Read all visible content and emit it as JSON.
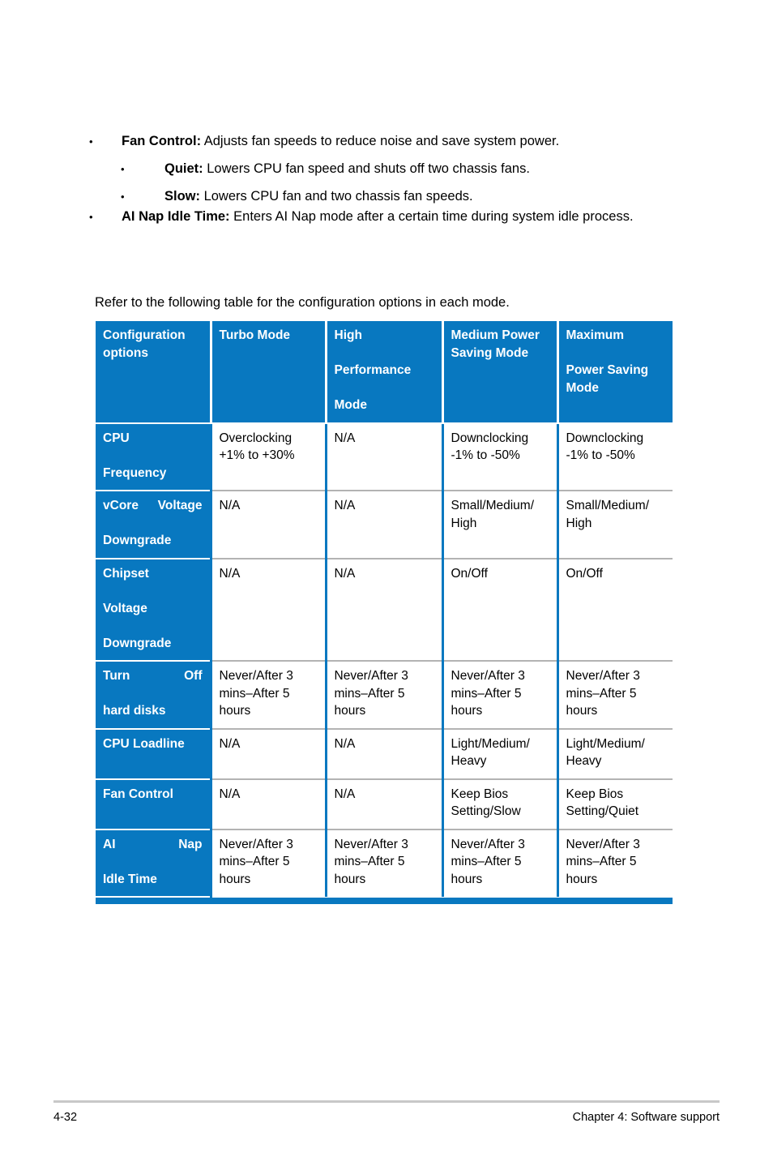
{
  "page": {
    "number": "4-32",
    "chapter_label": "Chapter 4: Software support"
  },
  "bullets": [
    {
      "level": 1,
      "marker": "•",
      "term": "Fan Control:",
      "text": " Adjusts fan speeds to reduce noise and save system power."
    },
    {
      "level": 2,
      "marker": "•",
      "term": "Quiet:",
      "text": " Lowers CPU fan speed and shuts off two chassis fans."
    },
    {
      "level": 2,
      "marker": "•",
      "term": "Slow:",
      "text": " Lowers CPU fan and two chassis fan speeds."
    },
    {
      "level": 1,
      "marker": "•",
      "term": "AI Nap Idle Time:",
      "text": " Enters AI Nap mode after a certain time during system idle process."
    }
  ],
  "intro": {
    "refer_text": "Refer to the following table for the configuration options in each mode."
  },
  "table": {
    "accent_color": "#0878c0",
    "header_text_color": "#ffffff",
    "row_separator_color": "#b3b3b3",
    "columns": [
      {
        "lines": [
          "Configuration",
          "options"
        ],
        "spread": [
          false,
          false
        ]
      },
      {
        "lines": [
          "Turbo Mode"
        ],
        "spread": [
          false
        ]
      },
      {
        "lines": [
          "High",
          "Performance",
          "Mode"
        ],
        "spread": [
          true,
          true,
          false
        ]
      },
      {
        "lines": [
          "Medium Power",
          "Saving Mode"
        ],
        "spread": [
          false,
          false
        ]
      },
      {
        "lines": [
          "Maximum",
          "Power Saving",
          "Mode"
        ],
        "spread": [
          true,
          false,
          false
        ]
      }
    ],
    "rows": [
      {
        "label_lines": [
          "CPU",
          "Frequency"
        ],
        "label_spread": [
          true,
          false
        ],
        "cells": [
          "Overclocking\n+1% to +30%",
          "N/A",
          "Downclocking\n-1% to -50%",
          "Downclocking\n-1% to -50%"
        ]
      },
      {
        "label_lines": [
          "vCore Voltage",
          "Downgrade"
        ],
        "label_spread": [
          true,
          false
        ],
        "cells": [
          "N/A",
          "N/A",
          "Small/Medium/\nHigh",
          "Small/Medium/\nHigh"
        ]
      },
      {
        "label_lines": [
          "Chipset",
          "Voltage",
          "Downgrade"
        ],
        "label_spread": [
          true,
          true,
          false
        ],
        "cells": [
          "N/A",
          "N/A",
          "On/Off",
          "On/Off"
        ]
      },
      {
        "label_lines": [
          "Turn Off",
          "hard disks"
        ],
        "label_spread": [
          true,
          false
        ],
        "cells": [
          "Never/After 3\nmins–After 5\nhours",
          "Never/After 3\nmins–After 5\nhours",
          "Never/After 3\nmins–After 5\nhours",
          "Never/After 3\nmins–After 5\nhours"
        ]
      },
      {
        "label_lines": [
          "CPU Loadline"
        ],
        "label_spread": [
          false
        ],
        "cells": [
          "N/A",
          "N/A",
          "Light/Medium/\nHeavy",
          "Light/Medium/\nHeavy"
        ]
      },
      {
        "label_lines": [
          "Fan Control"
        ],
        "label_spread": [
          false
        ],
        "cells": [
          "N/A",
          "N/A",
          "Keep Bios\nSetting/Slow",
          "Keep Bios\nSetting/Quiet"
        ]
      },
      {
        "label_lines": [
          "AI Nap",
          "Idle Time"
        ],
        "label_spread": [
          true,
          false
        ],
        "cells": [
          "Never/After 3\nmins–After 5\nhours",
          "Never/After 3\nmins–After 5\nhours",
          "Never/After 3\nmins–After 5\nhours",
          "Never/After 3\nmins–After 5\nhours"
        ]
      }
    ]
  }
}
